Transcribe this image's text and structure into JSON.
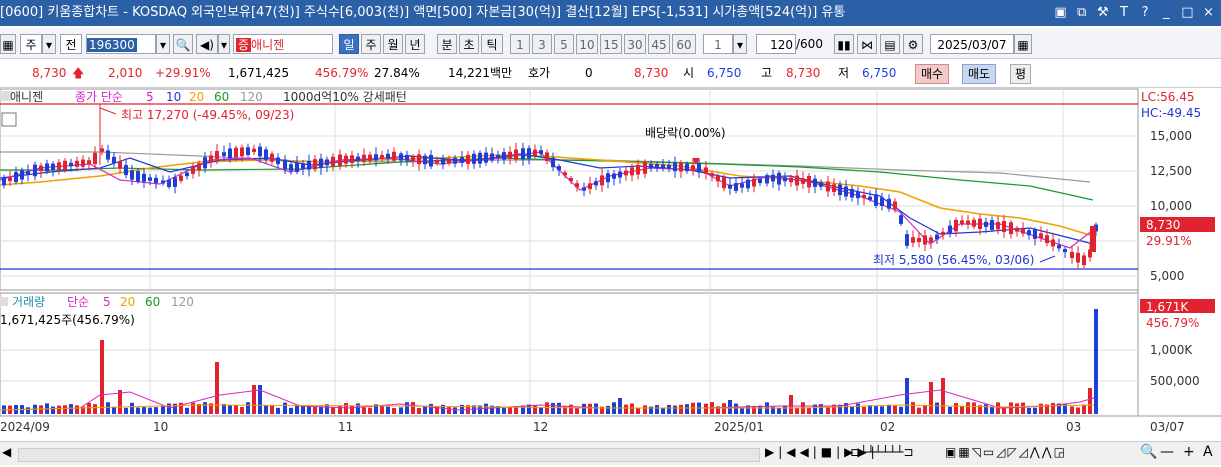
{
  "titlebar": {
    "text": "[0600] 키움종합차트 - KOSDAQ 외국인보유[47(천)] 주식수[6,003(천)] 액면[500] 자본금[30(억)] 결산[12월] EPS[-1,531] 시가총액[524(억)] 유통",
    "buttons": [
      "▣",
      "⧉",
      "⚒",
      "T",
      "?",
      "_",
      "□",
      "×"
    ]
  },
  "toolbar": {
    "period_day": "주",
    "prev_label": "전",
    "code": "196300",
    "name": "애니젠",
    "tabs": [
      "일",
      "주",
      "월",
      "년",
      "분",
      "초",
      "틱"
    ],
    "intervals": [
      "1",
      "3",
      "5",
      "10",
      "15",
      "30",
      "45",
      "60"
    ],
    "unit_value": "1",
    "count": "120",
    "total": "/600",
    "date": "2025/03/07"
  },
  "quote": {
    "price": "8,730",
    "change": "2,010",
    "change_pct": "+29.91%",
    "volume": "1,671,425",
    "vol_ratio": "456.79%",
    "turnover": "27.84%",
    "amount": "14,221백만",
    "hoga_label": "호가",
    "hoga_value": "0",
    "ask_price": "8,730",
    "open_label": "시",
    "open": "6,750",
    "high_label": "고",
    "high": "8,730",
    "low_label": "저",
    "low": "6,750",
    "buy": "매수",
    "sell": "매도",
    "eval": "평"
  },
  "price_panel": {
    "legend_name": "애니젠",
    "legend_close": "종가 단순",
    "legend_ma": [
      "5",
      "10",
      "20",
      "60",
      "120"
    ],
    "legend_pattern": "1000d억10% 강세패턴",
    "high_annotation": "최고 17,270 (-49.45%, 09/23)",
    "dividend_annotation": "배당락(0.00%)",
    "low_annotation": "최저 5,580 (56.45%, 03/06)",
    "lc": "LC:56.45",
    "hc": "HC:-49.45",
    "price_tag": "8,730",
    "pct_tag": "29.91%",
    "y_ticks": [
      "15,000",
      "12,500",
      "10,000",
      "7,500",
      "5,000"
    ]
  },
  "volume_panel": {
    "legend_name": "거래량",
    "legend_simple": "단순",
    "legend_ma": [
      "5",
      "20",
      "60",
      "120"
    ],
    "volume_text": "1,671,425주(456.79%)",
    "vol_tag": "1,671K",
    "vol_pct_tag": "456.79%",
    "y_ticks": [
      "1,000K",
      "500,000"
    ]
  },
  "x_axis": [
    "2024/09",
    "10",
    "11",
    "12",
    "2025/01",
    "02",
    "03",
    "03/07"
  ],
  "colors": {
    "up": "#e0232e",
    "down": "#1d3fd6",
    "ma5": "#d726c8",
    "ma10": "#2136d4",
    "ma20": "#f0a000",
    "ma60": "#1a9a2a",
    "ma120": "#9a9a9a"
  }
}
